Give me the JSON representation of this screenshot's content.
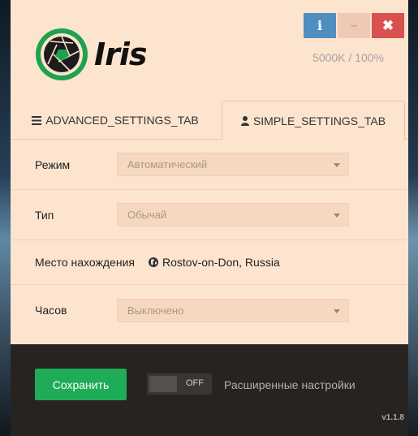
{
  "app": {
    "logo_text": "Iris",
    "status": "5000K / 100%",
    "version": "v1.1.8"
  },
  "window_buttons": {
    "info": "i",
    "minimize": "–",
    "close": "✖"
  },
  "tabs": [
    {
      "label": "ADVANCED_SETTINGS_TAB",
      "icon": "menu-icon",
      "active": false
    },
    {
      "label": "SIMPLE_SETTINGS_TAB",
      "icon": "user-icon",
      "active": true
    }
  ],
  "settings": {
    "mode": {
      "label": "Режим",
      "value": "Автоматический"
    },
    "type": {
      "label": "Тип",
      "value": "Обычай"
    },
    "location": {
      "label": "Место нахождения",
      "value": "Rostov-on-Don, Russia",
      "icon": "globe-icon"
    },
    "clock": {
      "label": "Часов",
      "value": "Выключено"
    }
  },
  "footer": {
    "save_label": "Сохранить",
    "toggle_state": "OFF",
    "advanced_label": "Расширенные настройки"
  },
  "colors": {
    "panel": "#fde4cf",
    "accent_green": "#1fac57",
    "info_blue": "#4e8fc0",
    "close_red": "#d8514f",
    "footer_dark": "#262321"
  }
}
